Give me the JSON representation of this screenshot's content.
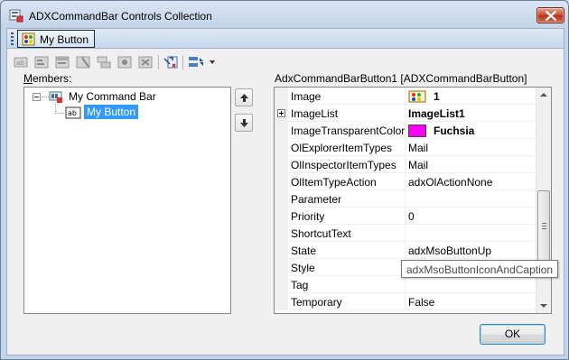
{
  "window": {
    "title": "ADXCommandBar Controls Collection"
  },
  "command_bar_preview": {
    "button_label": "My Button"
  },
  "toolbar": {
    "icons": [
      "button-control-icon",
      "combobox-control-icon",
      "dropdown-control-icon",
      "edit-control-icon",
      "popup-control-icon",
      "control-adv-icon",
      "remove-control-icon",
      "move-control-icon",
      "sort-dropdown-icon"
    ]
  },
  "members": {
    "label_prefix": "",
    "label_hotkey": "M",
    "label_rest": "embers:",
    "tree": [
      {
        "label": "My Command Bar",
        "expanded": true,
        "children": [
          {
            "label": "My Button",
            "selected": true
          }
        ]
      }
    ]
  },
  "properties": {
    "title": "AdxCommandBarButton1 [ADXCommandBarButton]",
    "rows": [
      {
        "name": "Image",
        "value": "1",
        "bold": true,
        "icon": "image-icon"
      },
      {
        "name": "ImageList",
        "value": "ImageList1",
        "bold": true,
        "expandable": true
      },
      {
        "name": "ImageTransparentColor",
        "value": "Fuchsia",
        "bold": true,
        "swatch": "#ff00ff"
      },
      {
        "name": "OlExplorerItemTypes",
        "value": "Mail"
      },
      {
        "name": "OlInspectorItemTypes",
        "value": "Mail"
      },
      {
        "name": "OlItemTypeAction",
        "value": "adxOlActionNone"
      },
      {
        "name": "Parameter",
        "value": ""
      },
      {
        "name": "Priority",
        "value": "0"
      },
      {
        "name": "ShortcutText",
        "value": ""
      },
      {
        "name": "State",
        "value": "adxMsoButtonUp"
      },
      {
        "name": "Style",
        "value": ""
      },
      {
        "name": "Tag",
        "value": ""
      },
      {
        "name": "Temporary",
        "value": "False"
      }
    ],
    "tooltip": "adxMsoButtonIconAndCaption"
  },
  "buttons": {
    "ok": "OK"
  },
  "colors": {
    "selection": "#3399ff",
    "fuchsia": "#ff00ff",
    "title_gradient_top": "#dae5f2"
  }
}
